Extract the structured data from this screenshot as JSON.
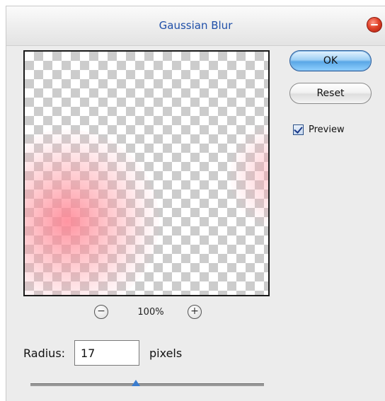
{
  "window": {
    "title": "Gaussian Blur"
  },
  "buttons": {
    "ok_label": "OK",
    "reset_label": "Reset"
  },
  "preview_checkbox": {
    "label": "Preview",
    "checked": true
  },
  "zoom": {
    "out_symbol": "−",
    "in_symbol": "+",
    "level": "100%"
  },
  "radius": {
    "label": "Radius:",
    "value": "17",
    "unit": "pixels",
    "slider_fraction": 0.45
  },
  "icons": {
    "close": "close-icon",
    "zoom_out": "zoom-out-icon",
    "zoom_in": "zoom-in-icon",
    "checkbox": "checkbox-checked-icon"
  },
  "colors": {
    "title_text": "#1f4fa8",
    "close_button": "#e0432a",
    "ok_button": "#5aa7e6",
    "blur_pink": "#ff8291",
    "slider_thumb": "#3a7ccf"
  }
}
